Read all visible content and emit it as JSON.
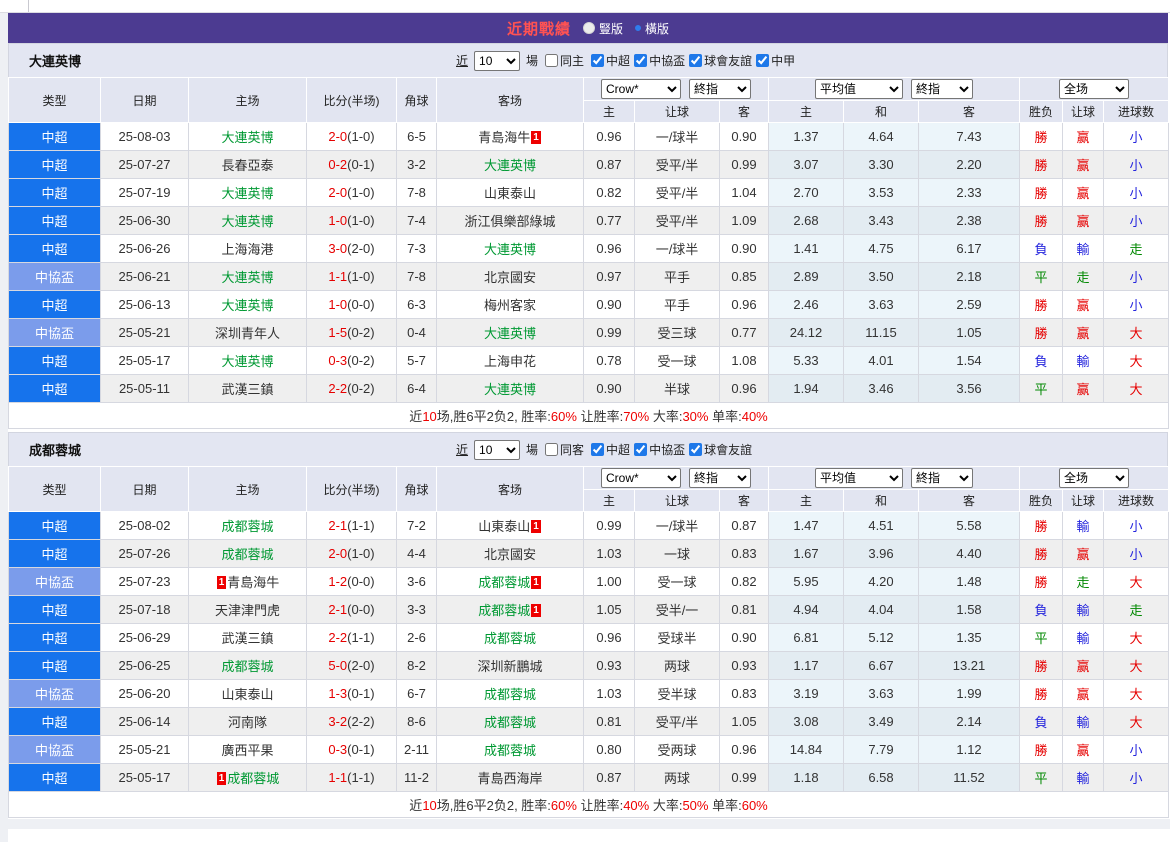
{
  "titlebar": {
    "title": "近期戰績",
    "radios": [
      {
        "label": "豎版",
        "selected": false
      },
      {
        "label": "橫版",
        "selected": true
      }
    ]
  },
  "colors": {
    "header_purple": "#4c3b91",
    "league_blue": "#1673ec",
    "cup_blue": "#7b9ceb",
    "focal_team_green": "#009933",
    "win_red": "#e60000",
    "lose_blue": "#2424dd",
    "draw_green": "#008800"
  },
  "filter_labels": {
    "near": "近",
    "games": "場"
  },
  "table_headers": {
    "type": "类型",
    "date": "日期",
    "home": "主场",
    "score": "比分(半场)",
    "corner": "角球",
    "away": "客场",
    "sub": [
      "主",
      "让球",
      "客",
      "主",
      "和",
      "客",
      "胜负",
      "让球",
      "进球数"
    ]
  },
  "sections": [
    {
      "team": "大連英博",
      "count": "10",
      "same_label": "同主",
      "same_checked": false,
      "leagues": [
        "中超",
        "中協盃",
        "球會友誼",
        "中甲"
      ],
      "selects": {
        "bookmaker": "Crow*",
        "final1": "終指",
        "average": "平均值",
        "final2": "終指",
        "scope": "全场"
      },
      "rows": [
        {
          "type": "中超",
          "kind": "csl",
          "date": "25-08-03",
          "home": {
            "name": "大連英博",
            "focal": true
          },
          "score": "2-0",
          "half": "(1-0)",
          "corner": "6-5",
          "away": {
            "name": "青島海牛",
            "badge_after": "1"
          },
          "odds": [
            "0.96",
            "一/球半",
            "0.90"
          ],
          "avg": [
            "1.37",
            "4.64",
            "7.43"
          ],
          "res": [
            [
              "勝",
              "r"
            ],
            [
              "赢",
              "r"
            ],
            [
              "小",
              "b"
            ]
          ]
        },
        {
          "type": "中超",
          "kind": "csl",
          "date": "25-07-27",
          "home": {
            "name": "長春亞泰"
          },
          "score": "0-2",
          "half": "(0-1)",
          "corner": "3-2",
          "away": {
            "name": "大連英博",
            "focal": true
          },
          "odds": [
            "0.87",
            "受平/半",
            "0.99"
          ],
          "avg": [
            "3.07",
            "3.30",
            "2.20"
          ],
          "res": [
            [
              "勝",
              "r"
            ],
            [
              "赢",
              "r"
            ],
            [
              "小",
              "b"
            ]
          ]
        },
        {
          "type": "中超",
          "kind": "csl",
          "date": "25-07-19",
          "home": {
            "name": "大連英博",
            "focal": true
          },
          "score": "2-0",
          "half": "(1-0)",
          "corner": "7-8",
          "away": {
            "name": "山東泰山"
          },
          "odds": [
            "0.82",
            "受平/半",
            "1.04"
          ],
          "avg": [
            "2.70",
            "3.53",
            "2.33"
          ],
          "res": [
            [
              "勝",
              "r"
            ],
            [
              "赢",
              "r"
            ],
            [
              "小",
              "b"
            ]
          ]
        },
        {
          "type": "中超",
          "kind": "csl",
          "date": "25-06-30",
          "home": {
            "name": "大連英博",
            "focal": true
          },
          "score": "1-0",
          "half": "(1-0)",
          "corner": "7-4",
          "away": {
            "name": "浙江俱樂部綠城"
          },
          "odds": [
            "0.77",
            "受平/半",
            "1.09"
          ],
          "avg": [
            "2.68",
            "3.43",
            "2.38"
          ],
          "res": [
            [
              "勝",
              "r"
            ],
            [
              "赢",
              "r"
            ],
            [
              "小",
              "b"
            ]
          ]
        },
        {
          "type": "中超",
          "kind": "csl",
          "date": "25-06-26",
          "home": {
            "name": "上海海港"
          },
          "score": "3-0",
          "half": "(2-0)",
          "corner": "7-3",
          "away": {
            "name": "大連英博",
            "focal": true
          },
          "odds": [
            "0.96",
            "一/球半",
            "0.90"
          ],
          "avg": [
            "1.41",
            "4.75",
            "6.17"
          ],
          "res": [
            [
              "負",
              "b"
            ],
            [
              "輸",
              "b"
            ],
            [
              "走",
              "g"
            ]
          ]
        },
        {
          "type": "中協盃",
          "kind": "cup",
          "date": "25-06-21",
          "home": {
            "name": "大連英博",
            "focal": true
          },
          "score": "1-1",
          "half": "(1-0)",
          "corner": "7-8",
          "away": {
            "name": "北京國安"
          },
          "odds": [
            "0.97",
            "平手",
            "0.85"
          ],
          "avg": [
            "2.89",
            "3.50",
            "2.18"
          ],
          "res": [
            [
              "平",
              "g"
            ],
            [
              "走",
              "g"
            ],
            [
              "小",
              "b"
            ]
          ]
        },
        {
          "type": "中超",
          "kind": "csl",
          "date": "25-06-13",
          "home": {
            "name": "大連英博",
            "focal": true
          },
          "score": "1-0",
          "half": "(0-0)",
          "corner": "6-3",
          "away": {
            "name": "梅州客家"
          },
          "odds": [
            "0.90",
            "平手",
            "0.96"
          ],
          "avg": [
            "2.46",
            "3.63",
            "2.59"
          ],
          "res": [
            [
              "勝",
              "r"
            ],
            [
              "赢",
              "r"
            ],
            [
              "小",
              "b"
            ]
          ]
        },
        {
          "type": "中協盃",
          "kind": "cup",
          "date": "25-05-21",
          "home": {
            "name": "深圳青年人"
          },
          "score": "1-5",
          "half": "(0-2)",
          "corner": "0-4",
          "away": {
            "name": "大連英博",
            "focal": true
          },
          "odds": [
            "0.99",
            "受三球",
            "0.77"
          ],
          "avg": [
            "24.12",
            "11.15",
            "1.05"
          ],
          "res": [
            [
              "勝",
              "r"
            ],
            [
              "赢",
              "r"
            ],
            [
              "大",
              "r"
            ]
          ]
        },
        {
          "type": "中超",
          "kind": "csl",
          "date": "25-05-17",
          "home": {
            "name": "大連英博",
            "focal": true
          },
          "score": "0-3",
          "half": "(0-2)",
          "corner": "5-7",
          "away": {
            "name": "上海申花"
          },
          "odds": [
            "0.78",
            "受一球",
            "1.08"
          ],
          "avg": [
            "5.33",
            "4.01",
            "1.54"
          ],
          "res": [
            [
              "負",
              "b"
            ],
            [
              "輸",
              "b"
            ],
            [
              "大",
              "r"
            ]
          ]
        },
        {
          "type": "中超",
          "kind": "csl",
          "date": "25-05-11",
          "home": {
            "name": "武漢三鎮"
          },
          "score": "2-2",
          "half": "(0-2)",
          "corner": "6-4",
          "away": {
            "name": "大連英博",
            "focal": true
          },
          "odds": [
            "0.90",
            "半球",
            "0.96"
          ],
          "avg": [
            "1.94",
            "3.46",
            "3.56"
          ],
          "res": [
            [
              "平",
              "g"
            ],
            [
              "赢",
              "r"
            ],
            [
              "大",
              "r"
            ]
          ]
        }
      ],
      "summary": [
        [
          "近",
          "k"
        ],
        [
          "10",
          "r"
        ],
        [
          "场,胜6平2负2, 胜率:",
          "k"
        ],
        [
          "60%",
          "r"
        ],
        [
          " 让胜率:",
          "k"
        ],
        [
          "70%",
          "r"
        ],
        [
          " 大率:",
          "k"
        ],
        [
          "30%",
          "r"
        ],
        [
          " 单率:",
          "k"
        ],
        [
          "40%",
          "r"
        ]
      ]
    },
    {
      "team": "成都蓉城",
      "count": "10",
      "same_label": "同客",
      "same_checked": false,
      "leagues": [
        "中超",
        "中協盃",
        "球會友誼"
      ],
      "selects": {
        "bookmaker": "Crow*",
        "final1": "終指",
        "average": "平均值",
        "final2": "終指",
        "scope": "全场"
      },
      "rows": [
        {
          "type": "中超",
          "kind": "csl",
          "date": "25-08-02",
          "home": {
            "name": "成都蓉城",
            "focal": true
          },
          "score": "2-1",
          "half": "(1-1)",
          "corner": "7-2",
          "away": {
            "name": "山東泰山",
            "badge_after": "1"
          },
          "odds": [
            "0.99",
            "一/球半",
            "0.87"
          ],
          "avg": [
            "1.47",
            "4.51",
            "5.58"
          ],
          "res": [
            [
              "勝",
              "r"
            ],
            [
              "輸",
              "b"
            ],
            [
              "小",
              "b"
            ]
          ]
        },
        {
          "type": "中超",
          "kind": "csl",
          "date": "25-07-26",
          "home": {
            "name": "成都蓉城",
            "focal": true
          },
          "score": "2-0",
          "half": "(1-0)",
          "corner": "4-4",
          "away": {
            "name": "北京國安"
          },
          "odds": [
            "1.03",
            "一球",
            "0.83"
          ],
          "avg": [
            "1.67",
            "3.96",
            "4.40"
          ],
          "res": [
            [
              "勝",
              "r"
            ],
            [
              "赢",
              "r"
            ],
            [
              "小",
              "b"
            ]
          ]
        },
        {
          "type": "中協盃",
          "kind": "cup",
          "date": "25-07-23",
          "home": {
            "name": "青島海牛",
            "badge_before": "1"
          },
          "score": "1-2",
          "half": "(0-0)",
          "corner": "3-6",
          "away": {
            "name": "成都蓉城",
            "focal": true,
            "badge_after": "1"
          },
          "odds": [
            "1.00",
            "受一球",
            "0.82"
          ],
          "avg": [
            "5.95",
            "4.20",
            "1.48"
          ],
          "res": [
            [
              "勝",
              "r"
            ],
            [
              "走",
              "g"
            ],
            [
              "大",
              "r"
            ]
          ]
        },
        {
          "type": "中超",
          "kind": "csl",
          "date": "25-07-18",
          "home": {
            "name": "天津津門虎"
          },
          "score": "2-1",
          "half": "(0-0)",
          "corner": "3-3",
          "away": {
            "name": "成都蓉城",
            "focal": true,
            "badge_after": "1"
          },
          "odds": [
            "1.05",
            "受半/一",
            "0.81"
          ],
          "avg": [
            "4.94",
            "4.04",
            "1.58"
          ],
          "res": [
            [
              "負",
              "b"
            ],
            [
              "輸",
              "b"
            ],
            [
              "走",
              "g"
            ]
          ]
        },
        {
          "type": "中超",
          "kind": "csl",
          "date": "25-06-29",
          "home": {
            "name": "武漢三鎮"
          },
          "score": "2-2",
          "half": "(1-1)",
          "corner": "2-6",
          "away": {
            "name": "成都蓉城",
            "focal": true
          },
          "odds": [
            "0.96",
            "受球半",
            "0.90"
          ],
          "avg": [
            "6.81",
            "5.12",
            "1.35"
          ],
          "res": [
            [
              "平",
              "g"
            ],
            [
              "輸",
              "b"
            ],
            [
              "大",
              "r"
            ]
          ]
        },
        {
          "type": "中超",
          "kind": "csl",
          "date": "25-06-25",
          "home": {
            "name": "成都蓉城",
            "focal": true
          },
          "score": "5-0",
          "half": "(2-0)",
          "corner": "8-2",
          "away": {
            "name": "深圳新鵬城"
          },
          "odds": [
            "0.93",
            "两球",
            "0.93"
          ],
          "avg": [
            "1.17",
            "6.67",
            "13.21"
          ],
          "res": [
            [
              "勝",
              "r"
            ],
            [
              "赢",
              "r"
            ],
            [
              "大",
              "r"
            ]
          ]
        },
        {
          "type": "中協盃",
          "kind": "cup",
          "date": "25-06-20",
          "home": {
            "name": "山東泰山"
          },
          "score": "1-3",
          "half": "(0-1)",
          "corner": "6-7",
          "away": {
            "name": "成都蓉城",
            "focal": true
          },
          "odds": [
            "1.03",
            "受半球",
            "0.83"
          ],
          "avg": [
            "3.19",
            "3.63",
            "1.99"
          ],
          "res": [
            [
              "勝",
              "r"
            ],
            [
              "赢",
              "r"
            ],
            [
              "大",
              "r"
            ]
          ]
        },
        {
          "type": "中超",
          "kind": "csl",
          "date": "25-06-14",
          "home": {
            "name": "河南隊"
          },
          "score": "3-2",
          "half": "(2-2)",
          "corner": "8-6",
          "away": {
            "name": "成都蓉城",
            "focal": true
          },
          "odds": [
            "0.81",
            "受平/半",
            "1.05"
          ],
          "avg": [
            "3.08",
            "3.49",
            "2.14"
          ],
          "res": [
            [
              "負",
              "b"
            ],
            [
              "輸",
              "b"
            ],
            [
              "大",
              "r"
            ]
          ]
        },
        {
          "type": "中協盃",
          "kind": "cup",
          "date": "25-05-21",
          "home": {
            "name": "廣西平果"
          },
          "score": "0-3",
          "half": "(0-1)",
          "corner": "2-11",
          "away": {
            "name": "成都蓉城",
            "focal": true
          },
          "odds": [
            "0.80",
            "受两球",
            "0.96"
          ],
          "avg": [
            "14.84",
            "7.79",
            "1.12"
          ],
          "res": [
            [
              "勝",
              "r"
            ],
            [
              "赢",
              "r"
            ],
            [
              "小",
              "b"
            ]
          ]
        },
        {
          "type": "中超",
          "kind": "csl",
          "date": "25-05-17",
          "home": {
            "name": "成都蓉城",
            "focal": true,
            "badge_before": "1"
          },
          "score": "1-1",
          "half": "(1-1)",
          "corner": "11-2",
          "away": {
            "name": "青島西海岸"
          },
          "odds": [
            "0.87",
            "两球",
            "0.99"
          ],
          "avg": [
            "1.18",
            "6.58",
            "11.52"
          ],
          "res": [
            [
              "平",
              "g"
            ],
            [
              "輸",
              "b"
            ],
            [
              "小",
              "b"
            ]
          ]
        }
      ],
      "summary": [
        [
          "近",
          "k"
        ],
        [
          "10",
          "r"
        ],
        [
          "场,胜6平2负2, 胜率:",
          "k"
        ],
        [
          "60%",
          "r"
        ],
        [
          " 让胜率:",
          "k"
        ],
        [
          "40%",
          "r"
        ],
        [
          " 大率:",
          "k"
        ],
        [
          "50%",
          "r"
        ],
        [
          " 单率:",
          "k"
        ],
        [
          "60%",
          "r"
        ]
      ]
    }
  ]
}
